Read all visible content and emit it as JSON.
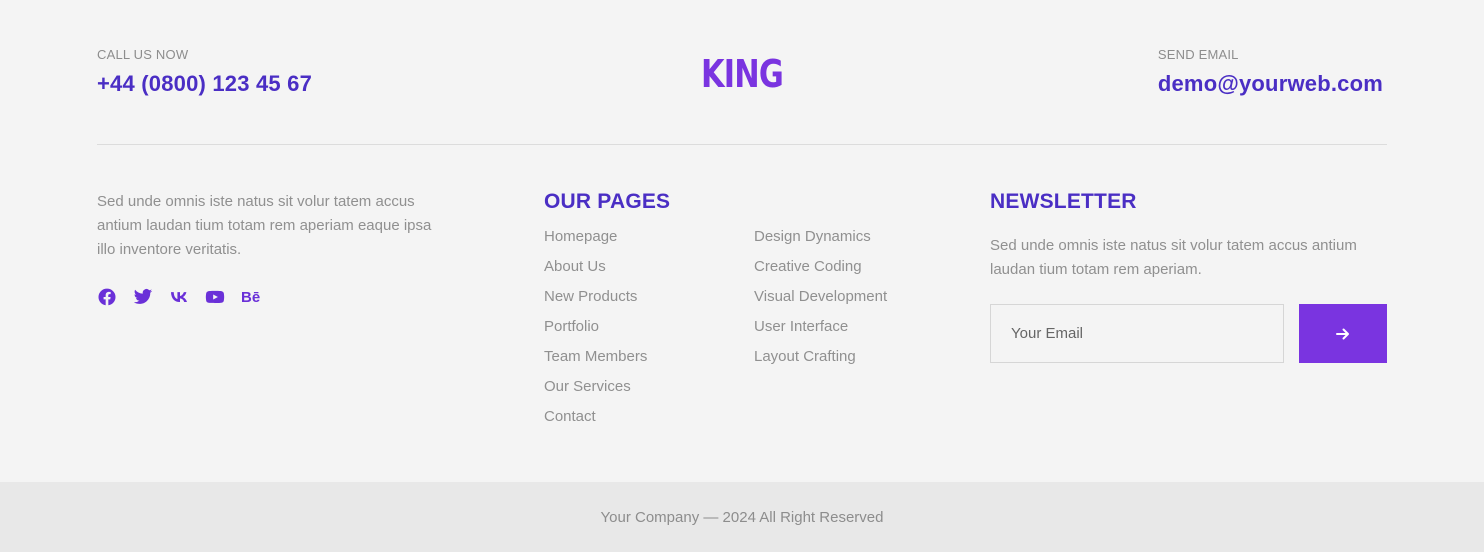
{
  "contact": {
    "call_label": "CALL US NOW",
    "phone": "+44 (0800) 123 45 67",
    "email_label": "SEND EMAIL",
    "email": "demo@yourweb.com"
  },
  "logo": "KING",
  "about": {
    "text": "Sed unde omnis iste natus sit volur tatem accus antium laudan tium totam rem aperiam eaque ipsa illo inventore veritatis.",
    "socials": [
      "facebook-icon",
      "twitter-icon",
      "vk-icon",
      "youtube-icon",
      "behance-icon"
    ],
    "behance_text": "Bē"
  },
  "pages": {
    "title": "OUR PAGES",
    "col1": [
      "Homepage",
      "About Us",
      "New Products",
      "Portfolio",
      "Team Members",
      "Our Services",
      "Contact"
    ],
    "col2": [
      "Design Dynamics",
      "Creative Coding",
      "Visual Development",
      "User Interface",
      "Layout Crafting"
    ]
  },
  "newsletter": {
    "title": "NEWSLETTER",
    "text": "Sed unde omnis iste natus sit volur tatem accus antium laudan tium totam rem aperiam.",
    "placeholder": "Your Email"
  },
  "footer": {
    "copyright": "Your Company — 2024 All Right Reserved"
  },
  "colors": {
    "accent": "#7a34e0",
    "heading": "#4a2ec4",
    "background": "#f4f4f4",
    "bottom_bar": "#e8e8e8"
  }
}
